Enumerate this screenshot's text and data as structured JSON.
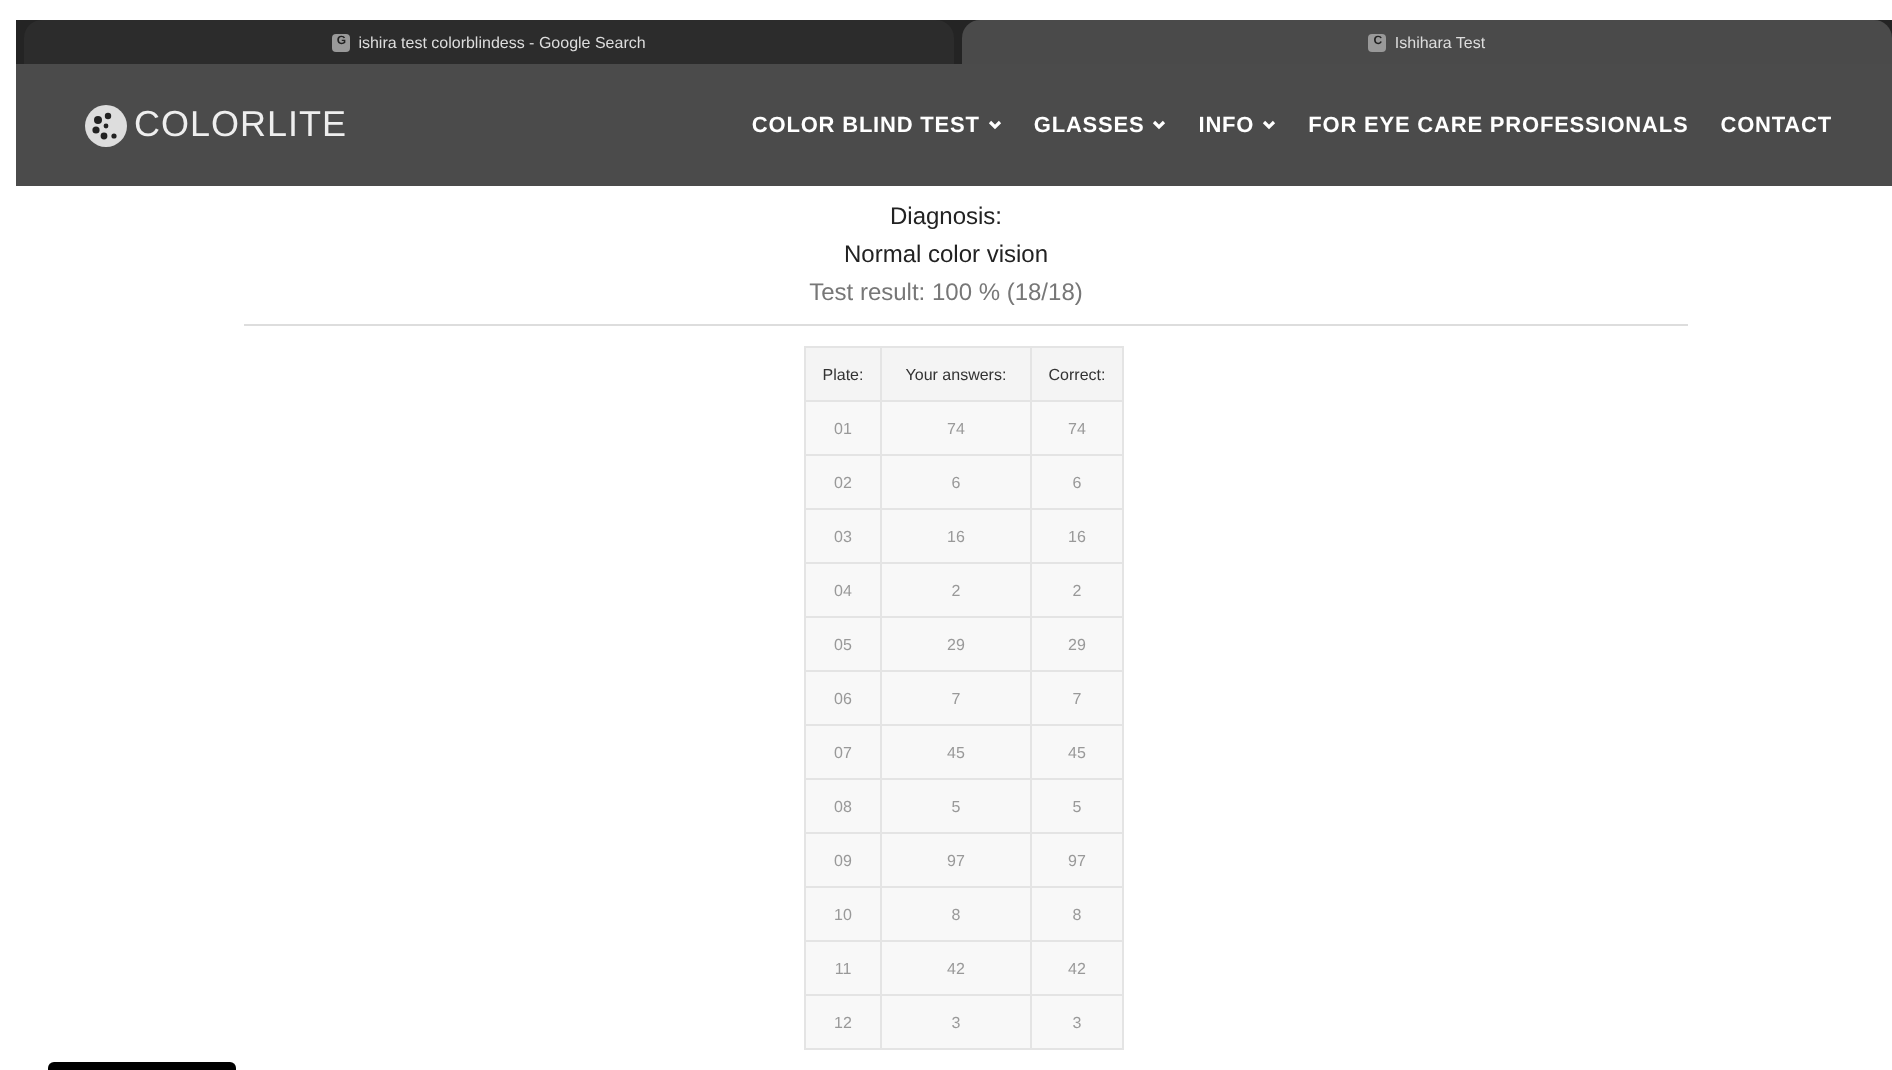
{
  "browser_tabs": [
    {
      "title": "ishira test colorblindess - Google Search",
      "favicon": "G",
      "selected": false
    },
    {
      "title": "Ishihara Test",
      "favicon": "C",
      "selected": true
    }
  ],
  "site": {
    "logo": "COLORLITE",
    "nav": [
      {
        "label": "COLOR BLIND TEST",
        "dropdown": true
      },
      {
        "label": "GLASSES",
        "dropdown": true
      },
      {
        "label": "INFO",
        "dropdown": true
      },
      {
        "label": "FOR EYE CARE PROFESSIONALS",
        "dropdown": false
      },
      {
        "label": "CONTACT",
        "dropdown": false
      }
    ]
  },
  "diagnosis": {
    "heading": "Diagnosis:",
    "result": "Normal color vision",
    "score": "Test result: 100 % (18/18)"
  },
  "table": {
    "columns": [
      "Plate:",
      "Your answers:",
      "Correct:"
    ],
    "rows": [
      [
        "01",
        "74",
        "74"
      ],
      [
        "02",
        "6",
        "6"
      ],
      [
        "03",
        "16",
        "16"
      ],
      [
        "04",
        "2",
        "2"
      ],
      [
        "05",
        "29",
        "29"
      ],
      [
        "06",
        "7",
        "7"
      ],
      [
        "07",
        "45",
        "45"
      ],
      [
        "08",
        "5",
        "5"
      ],
      [
        "09",
        "97",
        "97"
      ],
      [
        "10",
        "8",
        "8"
      ],
      [
        "11",
        "42",
        "42"
      ],
      [
        "12",
        "3",
        "3"
      ]
    ]
  }
}
